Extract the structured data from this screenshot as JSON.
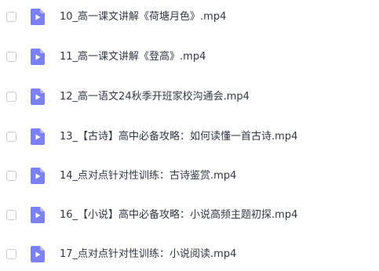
{
  "file_list": {
    "icon": "video-file-icon",
    "accent_color": "#7b81f2",
    "items": [
      {
        "name": "10_高一课文讲解《荷塘月色》.mp4"
      },
      {
        "name": "11_高一课文讲解《登高》.mp4"
      },
      {
        "name": "12_高一语文24秋季开班家校沟通会.mp4"
      },
      {
        "name": "13_【古诗】高中必备攻略：如何读懂一首古诗.mp4"
      },
      {
        "name": "14_点对点针对性训练：古诗鉴赏.mp4"
      },
      {
        "name": "16_【小说】高中必备攻略：小说高频主题初探.mp4"
      },
      {
        "name": "17_点对点针对性训练：小说阅读.mp4"
      }
    ]
  }
}
